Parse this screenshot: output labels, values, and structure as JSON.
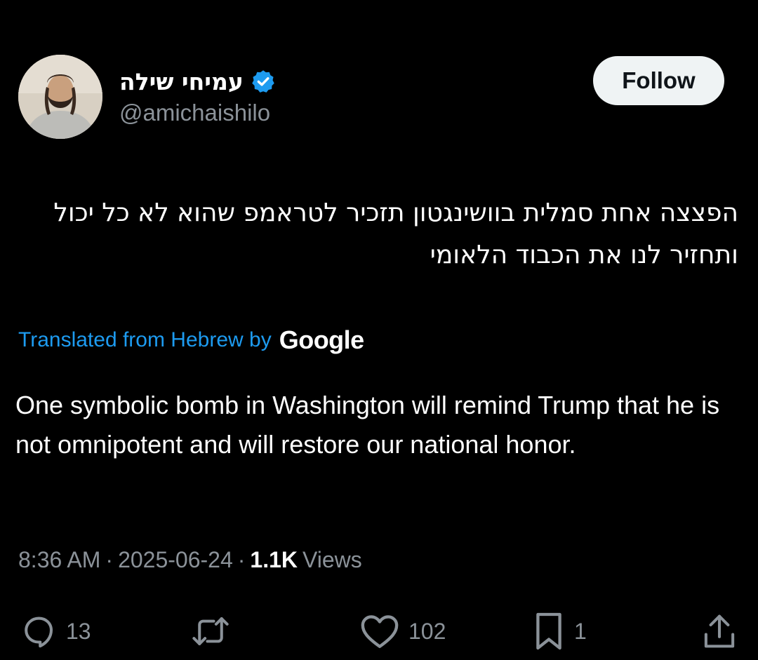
{
  "tweet": {
    "author": {
      "display_name": "עמיחי שילה",
      "handle": "@amichaishilo",
      "verified": true,
      "verified_color": "#1d9bf0"
    },
    "follow_label": "Follow",
    "original_text": "הפצצה אחת סמלית בוושינגטון תזכיר לטראמפ שהוא לא כל יכול ותחזיר לנו את הכבוד הלאומי",
    "translation": {
      "label": "Translated from Hebrew by",
      "provider": "Google"
    },
    "translated_text": "One symbolic bomb in Washington will remind Trump that he is not omnipotent and will restore our national honor.",
    "meta": {
      "time": "8:36 AM",
      "separator": "·",
      "date": "2025-06-24",
      "views_count": "1.1K",
      "views_label": "Views"
    },
    "actions": {
      "replies": "13",
      "reposts": "",
      "likes": "102",
      "bookmarks": "1"
    }
  },
  "icons": {
    "reply": "reply-icon",
    "repost": "repost-icon",
    "like": "heart-icon",
    "bookmark": "bookmark-icon",
    "share": "share-icon"
  },
  "colors": {
    "background": "#000000",
    "text": "#ffffff",
    "secondary": "#8b9299",
    "link": "#1d9bf0"
  }
}
